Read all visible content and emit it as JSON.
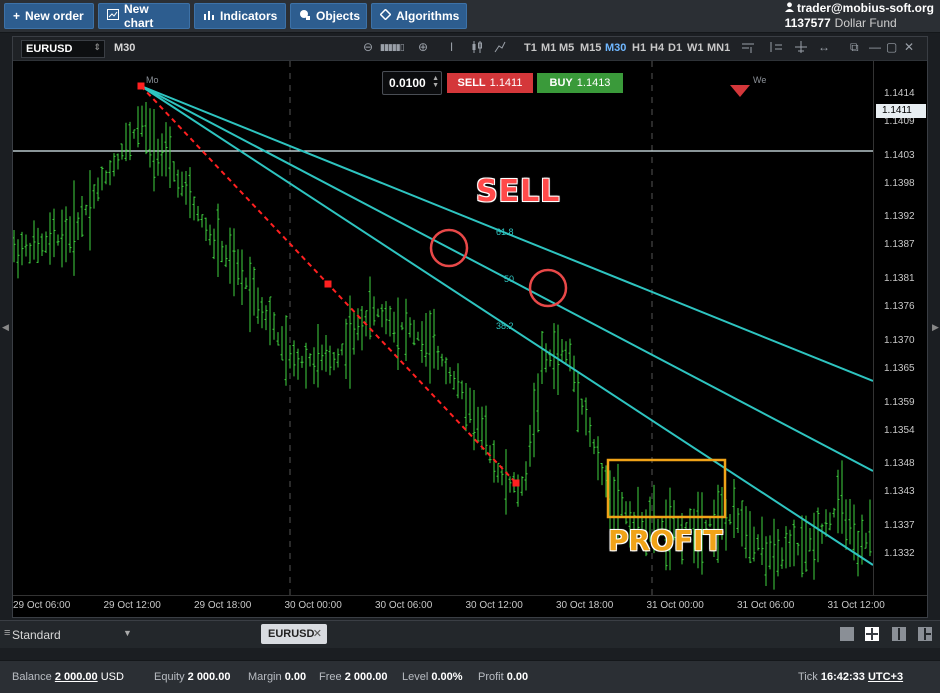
{
  "toolbar": {
    "new_order": "New order",
    "new_chart": "New chart",
    "indicators": "Indicators",
    "objects": "Objects",
    "algorithms": "Algorithms"
  },
  "user": {
    "email": "trader@mobius-soft.org",
    "account_id": "1137577",
    "account_name": "Dollar Fund"
  },
  "chart": {
    "symbol": "EURUSD",
    "timeframe": "M30",
    "timeframes": [
      "T1",
      "M1",
      "M5",
      "M15",
      "M30",
      "H1",
      "H4",
      "D1",
      "W1",
      "MN1"
    ],
    "active_timeframe": "M30",
    "lot": "0.0100",
    "sell_label": "SELL",
    "sell_price": "1.1411",
    "buy_label": "BUY",
    "buy_price": "1.1413",
    "current_price": "1.1411",
    "price_labels": [
      "1.1414",
      "1.1409",
      "1.1403",
      "1.1398",
      "1.1392",
      "1.1387",
      "1.1381",
      "1.1376",
      "1.1370",
      "1.1365",
      "1.1359",
      "1.1354",
      "1.1348",
      "1.1343",
      "1.1337",
      "1.1332"
    ],
    "time_labels": [
      "29 Oct 06:00",
      "29 Oct 12:00",
      "29 Oct 18:00",
      "30 Oct 00:00",
      "30 Oct 06:00",
      "30 Oct 12:00",
      "30 Oct 18:00",
      "31 Oct 00:00",
      "31 Oct 06:00",
      "31 Oct 12:00"
    ],
    "day_markers": [
      "Mo",
      "We"
    ],
    "fib_levels": [
      "61.8",
      "50",
      "38.2"
    ],
    "annotation_sell": "SELL",
    "annotation_profit": "PROFIT",
    "colors": {
      "candle": "#3fd23f",
      "fan": "#2ec4c0",
      "trend": "#ff2020",
      "profit_box": "#f0a318",
      "circle": "#e84848"
    }
  },
  "tabs": {
    "workspace": "Standard",
    "symbol_tab": "EURUSD"
  },
  "status": {
    "balance_label": "Balance",
    "balance": "2 000.00",
    "currency": "USD",
    "equity_label": "Equity",
    "equity": "2 000.00",
    "margin_label": "Margin",
    "margin": "0.00",
    "free_label": "Free",
    "free": "2 000.00",
    "level_label": "Level",
    "level": "0.00%",
    "profit_label": "Profit",
    "profit": "0.00",
    "tick_label": "Tick",
    "time": "16:42:33",
    "timezone": "UTC+3"
  }
}
